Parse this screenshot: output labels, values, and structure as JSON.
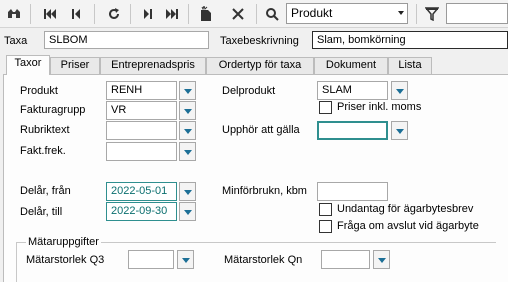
{
  "toolbar": {
    "buttons": [
      {
        "name": "binoculars-icon",
        "glyph": "☀"
      },
      {
        "name": "first-record-icon",
        "glyph": "⏮"
      },
      {
        "name": "previous-record-icon",
        "glyph": "⏴"
      },
      {
        "name": "refresh-icon",
        "glyph": "↻"
      },
      {
        "name": "next-record-icon",
        "glyph": "⏵"
      },
      {
        "name": "last-record-icon",
        "glyph": "⏭"
      },
      {
        "name": "new-record-icon",
        "glyph": "✨"
      },
      {
        "name": "delete-icon",
        "glyph": "✕"
      },
      {
        "name": "search-icon",
        "glyph": "⌕"
      },
      {
        "name": "filter-icon",
        "glyph": "▽"
      }
    ],
    "search_scope": "Produkt",
    "search_value": ""
  },
  "header": {
    "taxa_label": "Taxa",
    "taxa_value": "SLBOM",
    "taxebeskrivning_label": "Taxebeskrivning",
    "taxebeskrivning_value": "Slam, bomkörning"
  },
  "tabs": [
    "Taxor",
    "Priser",
    "Entreprenadspris",
    "Ordertyp för taxa",
    "Dokument",
    "Lista"
  ],
  "form": {
    "produkt_label": "Produkt",
    "produkt_value": "RENH",
    "fakturagrupp_label": "Fakturagrupp",
    "fakturagrupp_value": "VR",
    "rubriktext_label": "Rubriktext",
    "rubriktext_value": "",
    "faktfrek_label": "Fakt.frek.",
    "faktfrek_value": "",
    "delprodukt_label": "Delprodukt",
    "delprodukt_value": "SLAM",
    "priser_inkl_moms_label": "Priser inkl. moms",
    "upphor_label": "Upphör att gälla",
    "upphor_value": "",
    "delar_fran_label": "Delår, från",
    "delar_fran_value": "2022-05-01",
    "delar_till_label": "Delår, till",
    "delar_till_value": "2022-09-30",
    "minforbrukn_label": "Minförbrukn, kbm",
    "minforbrukn_value": "",
    "undantag_label": "Undantag för ägarbytesbrev",
    "fraga_label": "Fråga om avslut vid ägarbyte"
  },
  "matar": {
    "legend": "Mätaruppgifter",
    "q3_label": "Mätarstorlek Q3",
    "q3_value": "",
    "qn_label": "Mätarstorlek Qn",
    "qn_value": ""
  }
}
